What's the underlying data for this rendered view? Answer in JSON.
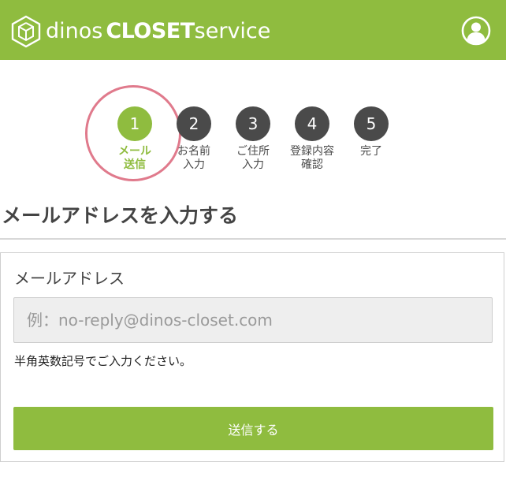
{
  "colors": {
    "brand_green": "#8fbc3f",
    "step_inactive": "#4a4a4a",
    "highlight_ring": "#e07a8c",
    "input_background": "#eeeeee"
  },
  "header": {
    "logo_icon": "hexagon-cube-icon",
    "logo_word1": "dinos",
    "logo_word2": "CLOSET",
    "logo_word3": "service",
    "account_icon": "user-account-icon"
  },
  "steps": [
    {
      "number": "1",
      "label_line1": "メール",
      "label_line2": "送信",
      "active": true
    },
    {
      "number": "2",
      "label_line1": "お名前",
      "label_line2": "入力",
      "active": false
    },
    {
      "number": "3",
      "label_line1": "ご住所",
      "label_line2": "入力",
      "active": false
    },
    {
      "number": "4",
      "label_line1": "登録内容",
      "label_line2": "確認",
      "active": false
    },
    {
      "number": "5",
      "label_line1": "完了",
      "label_line2": "",
      "active": false
    }
  ],
  "page_title": "メールアドレスを入力する",
  "form": {
    "email_label": "メールアドレス",
    "email_value": "",
    "email_placeholder": "例：no-reply@dinos-closet.com",
    "hint": "半角英数記号でご入力ください。",
    "submit_label": "送信する"
  }
}
